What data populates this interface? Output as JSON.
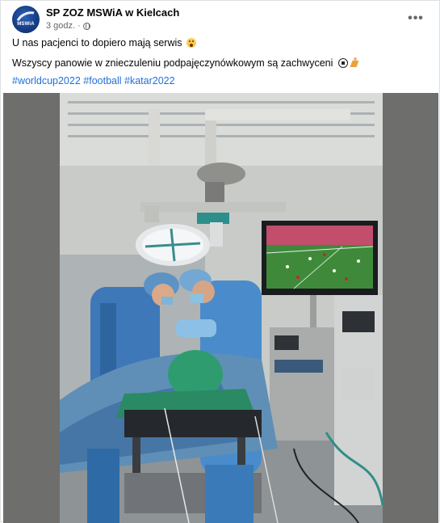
{
  "post": {
    "page_name": "SP ZOZ MSWiA w Kielcach",
    "avatar_text": "MSWiA",
    "time": "3 godz.",
    "separator": "·",
    "more_label": "•••",
    "text_line1": "U nas pacjenci to dopiero mają serwis",
    "text_line2": "Wszyscy panowie w znieczuleniu podpajęczynówkowym są zachwyceni",
    "hashtags": [
      "#worldcup2022",
      "#football",
      "#katar2022"
    ]
  },
  "icons": {
    "globe": "globe-icon",
    "more": "more-options-icon",
    "emoji1": "astonished-face-icon",
    "emoji2": "soccer-ball-icon",
    "emoji3": "person-running-icon"
  },
  "colors": {
    "hashtag": "#216fdb",
    "meta": "#65676b",
    "scrub": "#3e78b8",
    "tv_field": "#3f8a3a"
  }
}
